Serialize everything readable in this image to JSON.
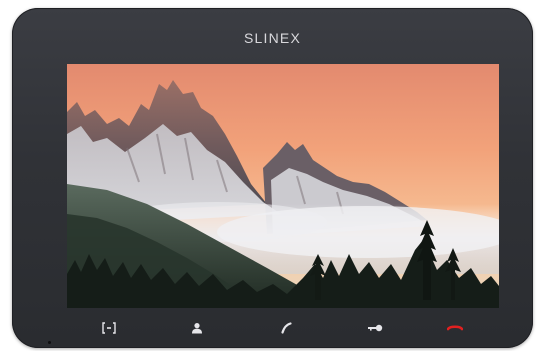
{
  "device": {
    "brand": "SLINEX"
  },
  "controls": [
    {
      "icon": "monitor-icon",
      "color": "#e6e6ea"
    },
    {
      "icon": "user-icon",
      "color": "#e6e6ea"
    },
    {
      "icon": "answer-handset-icon",
      "color": "#e6e6ea"
    },
    {
      "icon": "key-icon",
      "color": "#e6e6ea"
    },
    {
      "icon": "hang-up-icon",
      "color": "#e02020"
    }
  ],
  "colors": {
    "body": "#303237",
    "hangup": "#e02020"
  }
}
